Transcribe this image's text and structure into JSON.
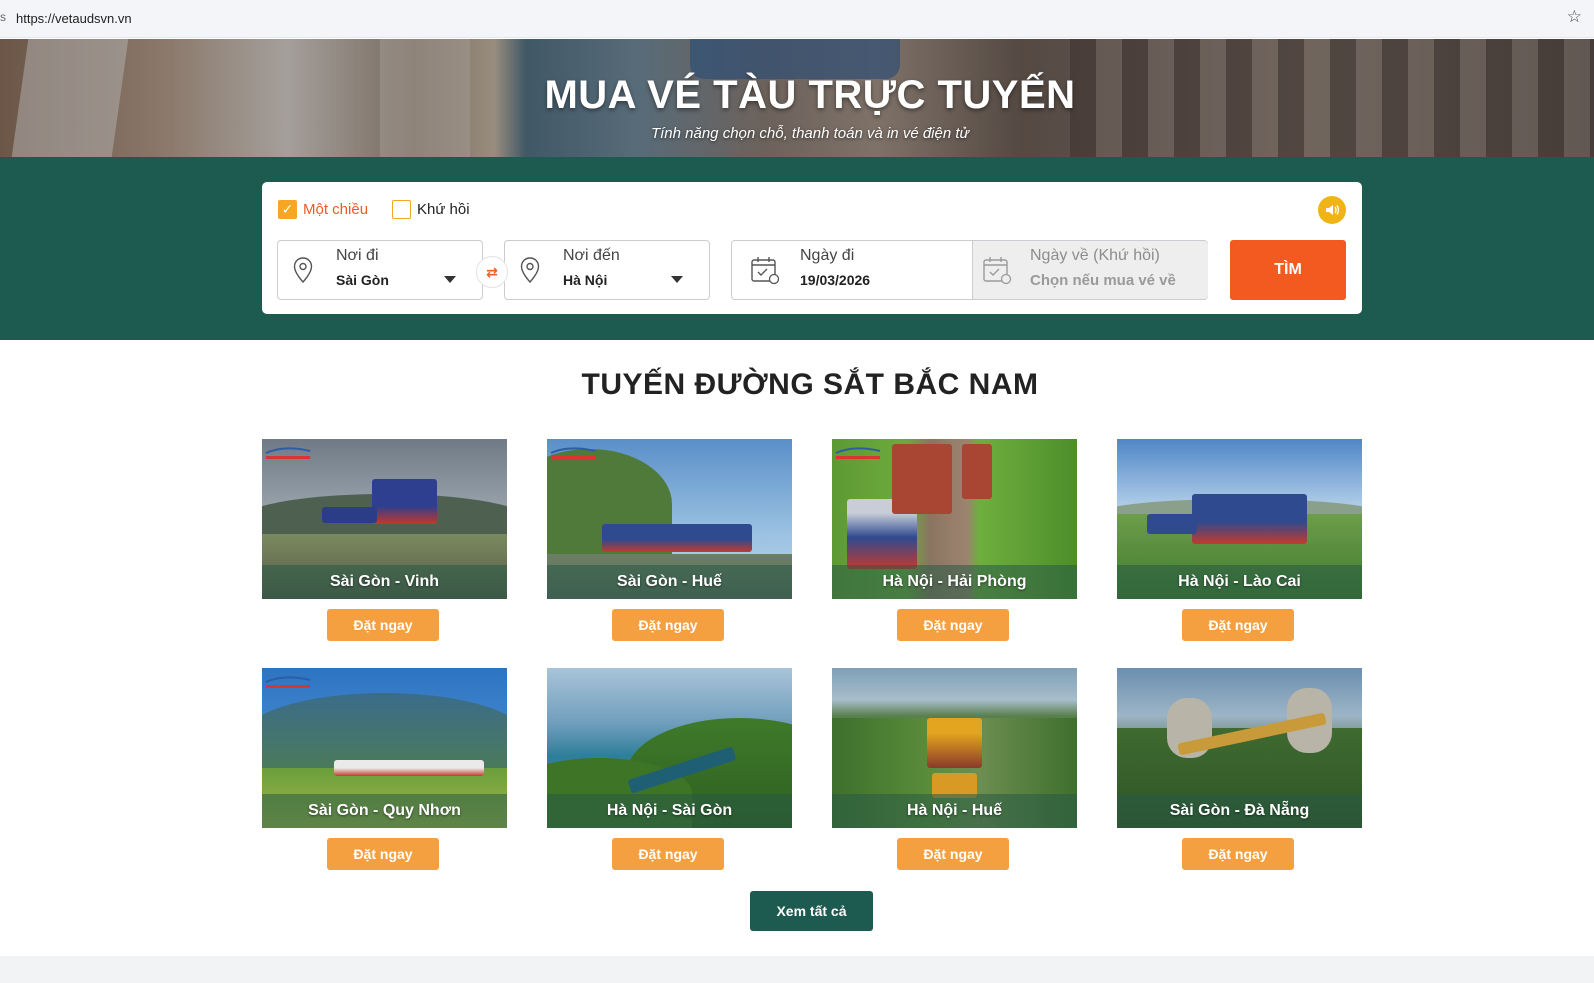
{
  "browser": {
    "url": "https://vetaudsvn.vn"
  },
  "hero": {
    "title": "MUA VÉ TÀU TRỰC TUYẾN",
    "subtitle": "Tính năng chọn chỗ, thanh toán và in vé điện tử"
  },
  "search": {
    "one_way": {
      "label": "Một chiều",
      "checked": true
    },
    "round_trip": {
      "label": "Khứ hồi",
      "checked": false
    },
    "from": {
      "label": "Nơi đi",
      "value": "Sài Gòn"
    },
    "to": {
      "label": "Nơi đến",
      "value": "Hà Nội"
    },
    "depart": {
      "label": "Ngày đi",
      "value": "19/03/2026"
    },
    "return": {
      "label": "Ngày về (Khứ hồi)",
      "value": "Chọn nếu mua vé về"
    },
    "button": "TÌM"
  },
  "routes": {
    "title": "TUYẾN ĐƯỜNG SẮT BẮC NAM",
    "book_label": "Đặt ngay",
    "items": [
      {
        "name": "Sài Gòn - Vinh"
      },
      {
        "name": "Sài Gòn - Huế"
      },
      {
        "name": "Hà Nội - Hải Phòng"
      },
      {
        "name": "Hà Nội - Lào Cai"
      },
      {
        "name": "Sài Gòn - Quy Nhơn"
      },
      {
        "name": "Hà Nội - Sài Gòn"
      },
      {
        "name": "Hà Nội - Huế"
      },
      {
        "name": "Sài Gòn - Đà Nẵng"
      }
    ],
    "view_all": "Xem tất cả"
  },
  "colors": {
    "brand_green": "#1d5a4f",
    "search_orange": "#f35a1f",
    "book_orange": "#f5a040",
    "check_yellow": "#f5a623"
  }
}
